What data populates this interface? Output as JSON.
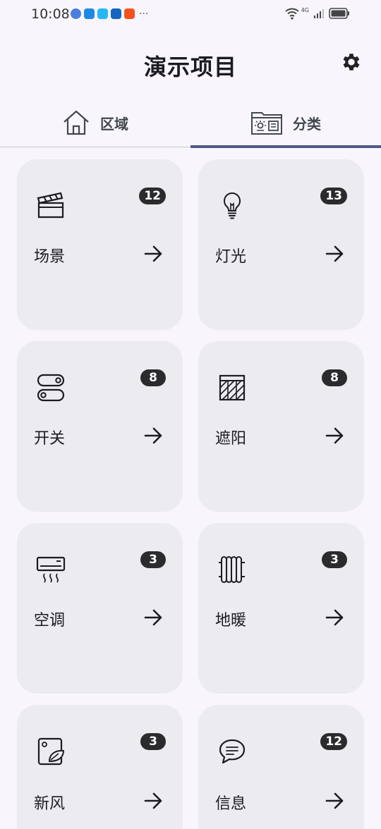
{
  "status_bar": {
    "time": "10:08",
    "network": "4G",
    "app_icons": [
      "#4a7de0",
      "#1e88e5",
      "#29b6f6",
      "#1565c0",
      "#f4511e"
    ],
    "more": "···"
  },
  "header": {
    "title": "演示项目",
    "settings_icon": "gear-icon"
  },
  "tabs": [
    {
      "label": "区域",
      "icon": "house-icon",
      "selected": false
    },
    {
      "label": "分类",
      "icon": "category-folder-icon",
      "selected": true
    }
  ],
  "accent_color": "#4d5a86",
  "categories": [
    {
      "label": "场景",
      "count": "12",
      "icon": "clapperboard-icon"
    },
    {
      "label": "灯光",
      "count": "13",
      "icon": "lightbulb-icon"
    },
    {
      "label": "开关",
      "count": "8",
      "icon": "switch-icon"
    },
    {
      "label": "遮阳",
      "count": "8",
      "icon": "blind-icon"
    },
    {
      "label": "空调",
      "count": "3",
      "icon": "air-conditioner-icon"
    },
    {
      "label": "地暖",
      "count": "3",
      "icon": "radiator-icon"
    },
    {
      "label": "新风",
      "count": "3",
      "icon": "fresh-air-icon"
    },
    {
      "label": "信息",
      "count": "12",
      "icon": "message-icon"
    }
  ]
}
